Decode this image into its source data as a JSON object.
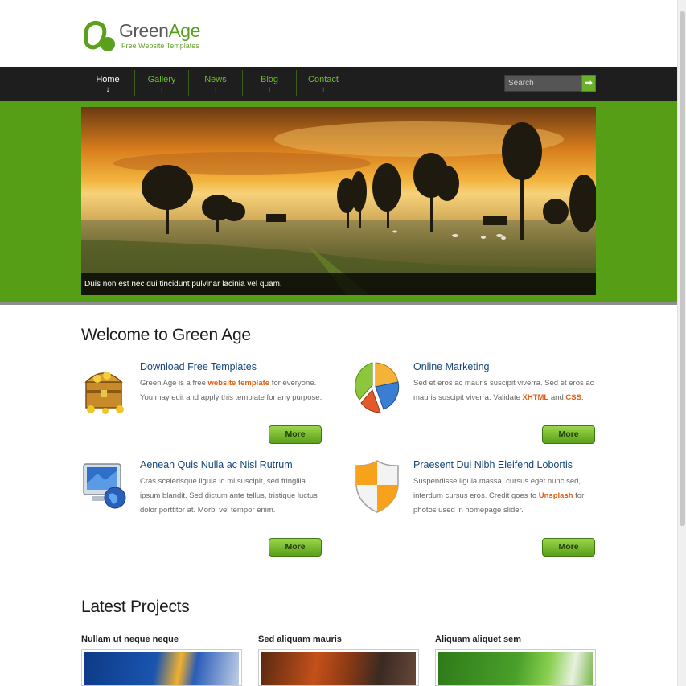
{
  "logo": {
    "title_part1": "Green",
    "title_part2": "Age",
    "subtitle": "Free Website Templates"
  },
  "nav": {
    "items": [
      {
        "label": "Home",
        "arrow": "↓",
        "active": true
      },
      {
        "label": "Gallery",
        "arrow": "↑",
        "active": false
      },
      {
        "label": "News",
        "arrow": "↑",
        "active": false
      },
      {
        "label": "Blog",
        "arrow": "↑",
        "active": false
      },
      {
        "label": "Contact",
        "arrow": "↑",
        "active": false
      }
    ],
    "search_placeholder": "Search",
    "search_button": "➡"
  },
  "slider": {
    "caption": "Duis non est nec dui tincidunt pulvinar lacinia vel quam."
  },
  "welcome": {
    "title": "Welcome to Green Age",
    "features": [
      {
        "icon": "treasure-chest-icon",
        "title": "Download Free Templates",
        "text_before": "Green Age is a free ",
        "highlight1": "website template",
        "text_middle": " for everyone. You may edit and apply this template for any purpose.",
        "highlight2": "",
        "text_after": "",
        "button": "More"
      },
      {
        "icon": "pie-chart-icon",
        "title": "Online Marketing",
        "text_before": "Sed et eros ac mauris suscipit viverra. Sed et eros ac mauris suscipit viverra. Validate ",
        "highlight1": "XHTML",
        "text_middle": " and ",
        "highlight2": "CSS",
        "text_after": ".",
        "button": "More"
      },
      {
        "icon": "computer-globe-icon",
        "title": "Aenean Quis Nulla ac Nisl Rutrum",
        "text_before": "Cras scelerisque ligula id mi suscipit, sed fringilla ipsum blandit. Sed dictum ante tellus, tristique luctus dolor porttitor at. Morbi vel tempor enim.",
        "highlight1": "",
        "text_middle": "",
        "highlight2": "",
        "text_after": "",
        "button": "More"
      },
      {
        "icon": "shield-icon",
        "title": "Praesent Dui Nibh Eleifend Lobortis",
        "text_before": "Suspendisse ligula massa, cursus eget nunc sed, interdum cursus eros. Credit goes to ",
        "highlight1": "Unsplash",
        "text_middle": " for photos used in homepage slider.",
        "highlight2": "",
        "text_after": "",
        "button": "More"
      }
    ]
  },
  "projects": {
    "title": "Latest Projects",
    "items": [
      {
        "title": "Nullam ut neque neque"
      },
      {
        "title": "Sed aliquam mauris"
      },
      {
        "title": "Aliquam aliquet sem"
      }
    ]
  },
  "colors": {
    "brand_green": "#579e17",
    "nav_bg": "#1e1e1e",
    "link_orange": "#e25e12",
    "title_blue": "#14457a"
  }
}
